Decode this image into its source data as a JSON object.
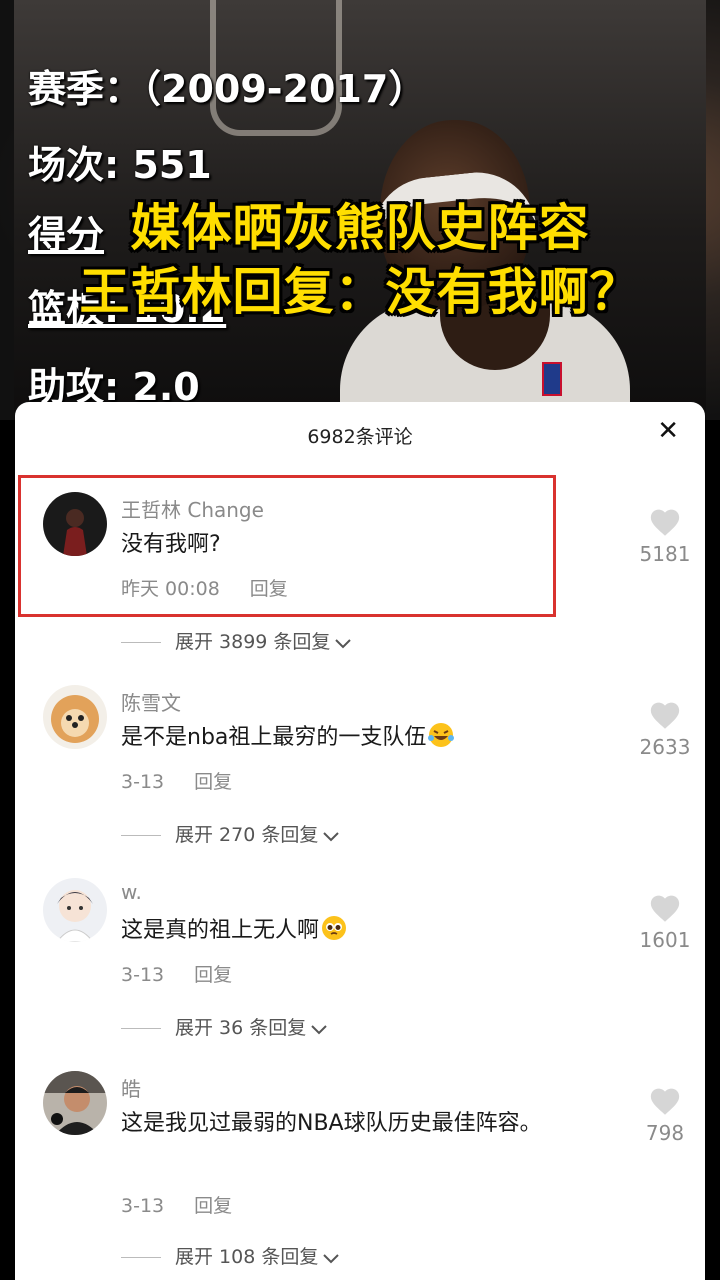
{
  "hero": {
    "stats": [
      "赛季：（2009-2017）",
      "场次: 551",
      "得分",
      "篮板: 10.2",
      "助攻: 2.0"
    ],
    "headline_line1": "媒体晒灰熊队史阵容",
    "headline_line2": "王哲林回复：没有我啊？"
  },
  "sheet": {
    "title": "6982条评论",
    "close_glyph": "✕"
  },
  "comments": [
    {
      "username": "王哲林 Change",
      "text": "没有我啊?",
      "time": "昨天 00:08",
      "reply": "回复",
      "likes": "5181",
      "expand": "展开 3899 条回复",
      "avatar_icon": "dark-jersey-avatar",
      "highlighted": true
    },
    {
      "username": "陈雪文",
      "text": "是不是nba祖上最穷的一支队伍",
      "emoji": "laughing-tears-emoji",
      "time": "3-13",
      "reply": "回复",
      "likes": "2633",
      "expand": "展开 270 条回复",
      "avatar_icon": "pomeranian-avatar"
    },
    {
      "username": "w.",
      "text": "这是真的祖上无人啊",
      "emoji": "pleading-face-emoji",
      "time": "3-13",
      "reply": "回复",
      "likes": "1601",
      "expand": "展开 36 条回复",
      "avatar_icon": "anime-girl-avatar"
    },
    {
      "username": "皓",
      "text": "这是我见过最弱的NBA球队历史最佳阵容。",
      "time": "3-13",
      "reply": "回复",
      "likes": "798",
      "expand": "展开 108 条回复",
      "avatar_icon": "man-photo-avatar"
    }
  ],
  "colors": {
    "headline": "#ffde00",
    "highlight_border": "#d9322f",
    "muted_text": "#8a8a8a",
    "heart": "#d6d6d6"
  }
}
